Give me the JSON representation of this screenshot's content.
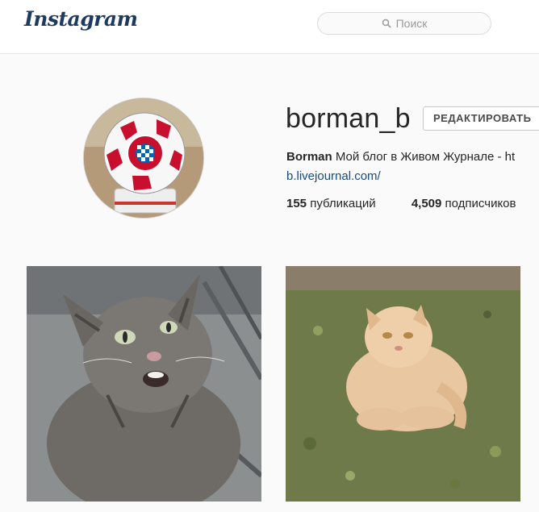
{
  "header": {
    "logo_text": "Instagram",
    "search_placeholder": "Поиск",
    "search_icon": "magnifier-icon"
  },
  "profile": {
    "username": "borman_b",
    "edit_button_label": "РЕДАКТИРОВАТЬ",
    "full_name": "Borman",
    "bio_text": "Мой блог в Живом Журнале - ht",
    "link_text": "b.livejournal.com/",
    "stats": [
      {
        "value": "155",
        "label": "публикаций"
      },
      {
        "value": "4,509",
        "label": "подписчиков"
      }
    ]
  },
  "posts": [
    {
      "name": "tabby-cat-photo"
    },
    {
      "name": "ginger-cat-photo"
    }
  ],
  "colors": {
    "logo": "#1f3a5f",
    "link": "#1a4a7a",
    "background": "#fafafa"
  }
}
